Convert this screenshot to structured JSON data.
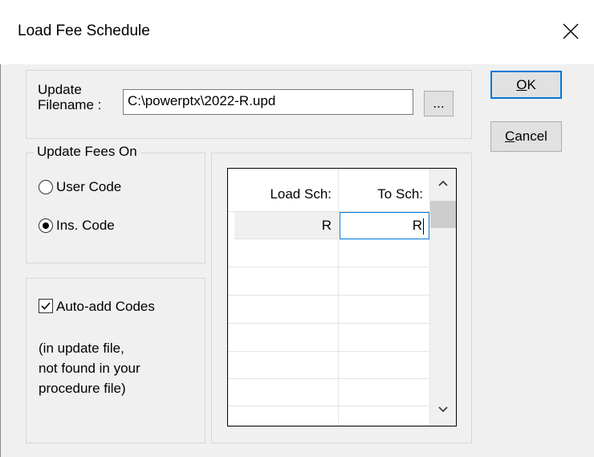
{
  "window": {
    "title": "Load Fee Schedule"
  },
  "update_file": {
    "label_line1": "Update",
    "label_line2": "Filename :",
    "value": "C:\\powerptx\\2022-R.upd",
    "browse_label": "..."
  },
  "buttons": {
    "ok_mnemonic": "O",
    "ok_rest": "K",
    "cancel_mnemonic": "C",
    "cancel_rest": "ancel"
  },
  "update_fees_on": {
    "legend": "Update Fees On",
    "options": [
      {
        "label": "User Code",
        "selected": false
      },
      {
        "label": "Ins. Code",
        "selected": true
      }
    ]
  },
  "auto_add": {
    "label": "Auto-add Codes",
    "checked": true,
    "note_line1": "(in update file,",
    "note_line2": "not found in your",
    "note_line3": "procedure file)"
  },
  "schedule_grid": {
    "columns": [
      "Load Sch:",
      "To Sch:"
    ],
    "rows": [
      {
        "load_sch": "R",
        "to_sch": "R"
      }
    ],
    "empty_rows": 7
  }
}
